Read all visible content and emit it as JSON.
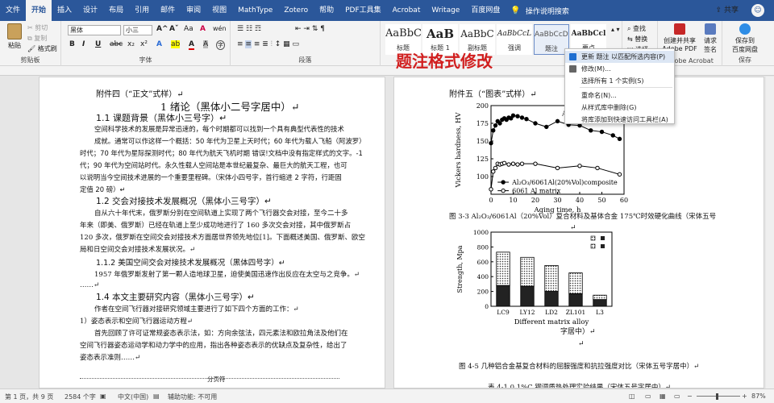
{
  "tabs": [
    "文件",
    "开始",
    "插入",
    "设计",
    "布局",
    "引用",
    "邮件",
    "审阅",
    "视图",
    "MathType",
    "Zotero",
    "帮助",
    "PDF工具集",
    "Acrobat",
    "Writage",
    "百度网盘"
  ],
  "active_tab": "开始",
  "tell_me": "操作说明搜索",
  "share": "共享",
  "avatar": "☺",
  "clipboard": {
    "paste": "粘贴",
    "cut": "剪切",
    "copy": "复制",
    "format_painter": "格式刷",
    "label": "剪贴板"
  },
  "font": {
    "name": "黑体",
    "size": "小三",
    "label": "字体",
    "bold": "B",
    "italic": "I",
    "underline": "U",
    "strike": "abc",
    "sub": "x₂",
    "sup": "x²",
    "grow": "A^",
    "shrink": "Aˇ",
    "case": "Aa",
    "clear": "A",
    "phonetic": "wén",
    "border": "A",
    "highlight": "ab",
    "color": "A",
    "shade": "A",
    "circle": "字"
  },
  "paragraph": {
    "label": "段落"
  },
  "styles": [
    {
      "preview": "AaBbC",
      "name": "标题"
    },
    {
      "preview": "AaB",
      "name": "标题 1"
    },
    {
      "preview": "AaBbC",
      "name": "副标题"
    },
    {
      "preview": "AaBbCcL",
      "name": "强调"
    },
    {
      "preview": "AaBbCcDc",
      "name": "题注"
    },
    {
      "preview": "AaBbCcl",
      "name": "要点"
    }
  ],
  "editing": {
    "find": "查找",
    "replace": "替换",
    "select": "选择"
  },
  "acrobat": {
    "create_share": "创建并共享",
    "pdf": "Adobe PDF",
    "request": "请求",
    "sign": "签名",
    "adobe": "Adobe Acrobat"
  },
  "baidu": {
    "save": "保存到",
    "netdisk": "百度网盘",
    "label": "保存"
  },
  "context_menu": [
    "更新 题注 以匹配所选内容(P)",
    "修改(M)...",
    "选择所有 1 个实例(S)",
    "重命名(N)...",
    "从样式库中删除(G)",
    "将库添加到快速访问工具栏(A)"
  ],
  "callout": "题注格式修改",
  "left_page": {
    "lines": [
      "附件四（“正文”式样）↵",
      "1 绪论（黑体小二号字居中）↵",
      "1.1 课题背景（黑体小三号字）↵",
      "空间科学技术的发展是异常迅速的，每个时期都可以找到一个具有典型代表性的技术",
      "成就。通常可以作这样一个概括：50 年代为卫星上天时代；60 年代为载人飞船（阿波罗）",
      "时代；70 年代为星际探测时代；80 年代为航天飞机时期 错误!文档中没有指定样式的文字。-1",
      "代；90 年代为空间站时代。永久性载人空间站是本世纪最复杂、最巨大的航天工程，也可",
      "以说明当今空间技术进展的一个重要里程碑。（宋体小四号字，首行缩进 2 字符，行距固",
      "定值 20 磅）↵",
      "1.2 交会对接技术发展概况（黑体小三号字）↵",
      "自从六十年代末，俄罗斯分别在空间轨道上实现了两个飞行器交会对接，至今二十多",
      "年来（即美、俄罗斯）已经在轨道上至少成功地进行了 160 多次交会对接，其中俄罗斯占",
      "120 多次，俄罗斯在空间交会对接技术方面居世界领先地位[1]。下面概述美国、俄罗斯、欧空",
      "局和日空间交会对接技术发展状况。↵",
      "1.1.2 美国空间交会对接技术发展概况（黑体四号字）↵",
      "1957 年俄罗斯发射了第一颗人造地球卫星，迫使美国迅速作出反应在太空与之竞争。↵",
      "……↵",
      "1.4 本文主要研究内容（黑体小三号字）↵",
      "作者在空间飞行器对接研究领域主要进行了如下四个方面的工作：↵",
      "1）姿态表示和空间飞行器运动方程↵",
      "首先回顾了许可证常规姿态表示法，如：方向余弦法，四元素法和欧拉角法及他们在",
      "空间飞行器姿态运动学和动力学中的应用，指出各种姿态表示的优缺点及复杂性，给出了",
      "姿态表示准则……↵",
      "分页符"
    ]
  },
  "right_page": {
    "heading": "附件五（“图表”式样）↵",
    "fig1_caption": "图 3-3 Al₂O₃/6061Al（20%Vol）复合材料及基体合金 175℃时效硬化曲线（宋体五号",
    "fig2_caption_tail": "字居中）↵",
    "fig2_caption": "图 4-5 几种铝合金基复合材料的屈服强度和抗拉强度对比（宋体五号字居中）↵",
    "table_caption": "表 4-1    0.1%C 钢调质热处理实验结果（宋体五号字居中）↵",
    "marks": [
      "↵",
      "↵"
    ]
  },
  "chart_data": [
    {
      "type": "line",
      "title": "",
      "xlabel": "Aging time, h",
      "ylabel": "Vickers hardness, HV",
      "xlim": [
        0,
        60
      ],
      "ylim": [
        75,
        200
      ],
      "xticks": [
        0,
        10,
        20,
        30,
        40,
        50,
        60
      ],
      "yticks": [
        100,
        125,
        150,
        175,
        200
      ],
      "annotation": "Aged at 175℃",
      "series": [
        {
          "name": "Al₂O₃/6061Al(20%Vol)composite",
          "marker": "filled",
          "x": [
            0,
            1,
            2,
            3,
            4,
            5,
            6,
            7,
            8,
            9,
            10,
            12,
            14,
            16,
            20,
            25,
            30,
            35,
            40,
            45,
            50,
            55,
            58
          ],
          "y": [
            147,
            165,
            172,
            178,
            175,
            180,
            182,
            180,
            183,
            182,
            186,
            185,
            183,
            181,
            175,
            170,
            178,
            173,
            172,
            165,
            163,
            158,
            153
          ]
        },
        {
          "name": "6061 Al matrix",
          "marker": "open",
          "x": [
            0,
            1,
            2,
            3,
            4,
            5,
            6,
            8,
            10,
            12,
            14,
            20,
            30,
            40,
            48,
            58
          ],
          "y": [
            82,
            107,
            112,
            118,
            117,
            118,
            119,
            117,
            118,
            117,
            118,
            118,
            112,
            115,
            112,
            103
          ]
        }
      ]
    },
    {
      "type": "bar",
      "title": "",
      "xlabel": "Different matrix alloy",
      "ylabel": "Strength, Mpa",
      "ylim": [
        0,
        1000
      ],
      "yticks": [
        0,
        200,
        400,
        600,
        800,
        1000
      ],
      "categories": [
        "LC9",
        "LY12",
        "LD2",
        "ZL101",
        "L3"
      ],
      "series": [
        {
          "name": "",
          "values": [
            730,
            660,
            550,
            450,
            150
          ]
        },
        {
          "name": "",
          "values": [
            280,
            270,
            200,
            170,
            90
          ]
        }
      ]
    }
  ],
  "status": {
    "page": "第 1 页，共 9 页",
    "words": "2584 个字",
    "lang": "中文(中国)",
    "access": "辅助功能: 不可用",
    "zoom": "87%"
  }
}
